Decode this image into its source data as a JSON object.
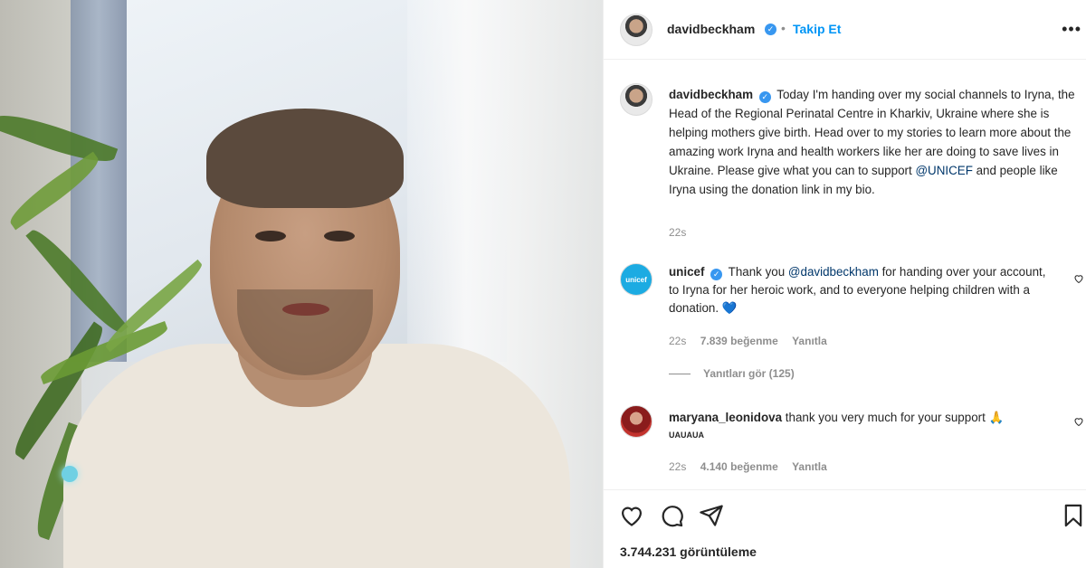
{
  "post": {
    "author": "davidbeckham",
    "follow_label": "Takip Et",
    "caption_author": "davidbeckham",
    "caption_before": "Today I'm handing over my social channels to Iryna, the Head of the Regional Perinatal Centre in Kharkiv, Ukraine where she is helping mothers give birth. Head over to my stories to learn more about the amazing work Iryna and health workers like her are doing to save lives in Ukraine. Please give what you can to support ",
    "caption_mention": "@UNICEF",
    "caption_after": " and people like Iryna using the donation link in my bio.",
    "caption_time": "22s"
  },
  "comments": [
    {
      "user": "unicef",
      "avatar_text": "unicef",
      "text_before": "Thank you ",
      "mention": "@davidbeckham",
      "text_after": " for handing over your account, to Iryna for her heroic work, and to everyone helping children with a donation. 💙",
      "time": "22s",
      "likes": "7.839 beğenme",
      "reply_label": "Yanıtla",
      "view_replies": "Yanıtları gör (125)"
    },
    {
      "user": "maryana_leonidova",
      "text": "thank you very much for your support 🙏",
      "tag": "UAUAUA",
      "time": "22s",
      "likes": "4.140 beğenme",
      "reply_label": "Yanıtla"
    }
  ],
  "footer": {
    "views": "3.744.231 görüntüleme"
  },
  "colors": {
    "accent": "#0095f6",
    "verified": "#3897f0",
    "muted": "#8e8e8e",
    "unicef": "#1cabe2"
  },
  "icons": [
    "verified-badge-icon",
    "more-options-icon",
    "heart-icon",
    "comment-icon",
    "share-icon",
    "bookmark-icon"
  ]
}
